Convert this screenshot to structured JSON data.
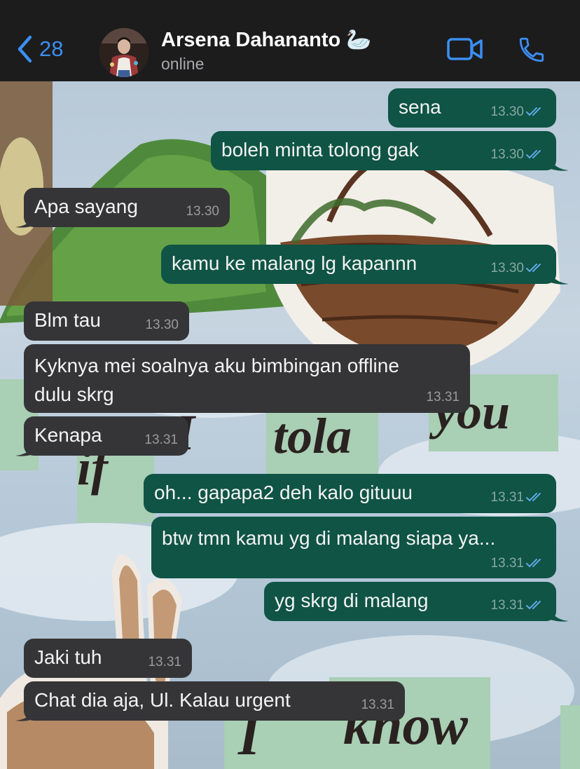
{
  "header": {
    "back_count": "28",
    "contact_name": "Arsena Dahananto 🦢",
    "status": "online"
  },
  "colors": {
    "accent": "#3b8ff3",
    "outgoing_bubble": "#0f5445",
    "incoming_bubble": "#353537",
    "read_tick": "#5fa8e6"
  },
  "icons": {
    "back": "chevron-left-icon",
    "video": "video-camera-icon",
    "call": "phone-icon",
    "read": "double-check-icon"
  },
  "messages": [
    {
      "dir": "out",
      "text": "sena",
      "time": "13.30"
    },
    {
      "dir": "out",
      "text": "boleh minta tolong gak",
      "time": "13.30"
    },
    {
      "dir": "in",
      "text": "Apa sayang",
      "time": "13.30"
    },
    {
      "dir": "out",
      "text": "kamu ke malang lg kapannn",
      "time": "13.30"
    },
    {
      "dir": "in",
      "text": "Blm tau",
      "time": "13.30"
    },
    {
      "dir": "in",
      "line1": "Kyknya mei soalnya aku bimbingan offline",
      "line2": "dulu skrg",
      "time": "13.31"
    },
    {
      "dir": "in",
      "text": "Kenapa",
      "time": "13.31"
    },
    {
      "dir": "out",
      "text": "oh... gapapa2 deh kalo gituuu",
      "time": "13.31"
    },
    {
      "dir": "out",
      "text": "btw tmn kamu yg di malang siapa ya...",
      "time": "13.31"
    },
    {
      "dir": "out",
      "text": "yg skrg di malang",
      "time": "13.31"
    },
    {
      "dir": "in",
      "text": "Jaki tuh",
      "time": "13.31"
    },
    {
      "dir": "in",
      "text": "Chat dia aja, Ul. Kalau urgent",
      "time": "13.31"
    }
  ]
}
